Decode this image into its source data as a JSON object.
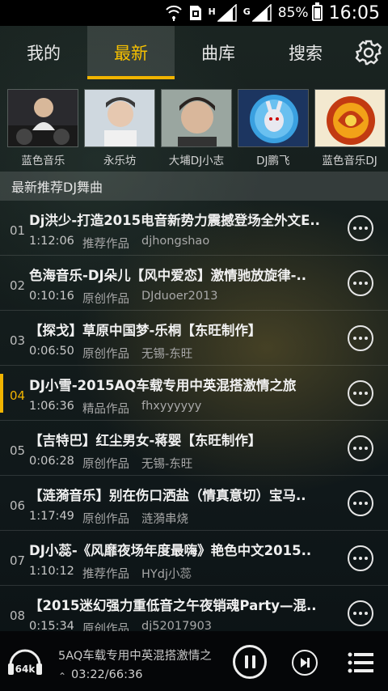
{
  "status_bar": {
    "network_letter_1": "H",
    "network_letter_2": "G",
    "battery": "85%",
    "time": "16:05"
  },
  "tabs": [
    {
      "label": "我的"
    },
    {
      "label": "最新"
    },
    {
      "label": "曲库"
    },
    {
      "label": "搜索"
    }
  ],
  "active_tab": "最新",
  "artists": [
    {
      "name": "蓝色音乐"
    },
    {
      "name": "永乐坊"
    },
    {
      "name": "大埔DJ小志"
    },
    {
      "name": "DJ鹏飞"
    },
    {
      "name": "蓝色音乐DJ"
    }
  ],
  "section_title": "最新推荐DJ舞曲",
  "tracks": [
    {
      "index": "01",
      "title": "Dj洪少-打造2015电音新势力震撼登场全外文E..",
      "duration": "1:12:06",
      "type": "推荐作品",
      "uploader": "djhongshao"
    },
    {
      "index": "02",
      "title": "色海音乐-DJ朵儿【风中爱恋】激情驰放旋律-..",
      "duration": "0:10:16",
      "type": "原创作品",
      "uploader": "DJduoer2013"
    },
    {
      "index": "03",
      "title": "【探戈】草原中国梦-乐桐【东旺制作】",
      "duration": "0:06:50",
      "type": "原创作品",
      "uploader": "无锡-东旺"
    },
    {
      "index": "04",
      "title": "DJ小雪-2015AQ车载专用中英混搭激情之旅",
      "duration": "1:06:36",
      "type": "精品作品",
      "uploader": "fhxyyyyyy"
    },
    {
      "index": "05",
      "title": "【吉特巴】红尘男女-蒋婴【东旺制作】",
      "duration": "0:06:28",
      "type": "原创作品",
      "uploader": "无锡-东旺"
    },
    {
      "index": "06",
      "title": "【涟漪音乐】别在伤口洒盐（情真意切）宝马..",
      "duration": "1:17:49",
      "type": "原创作品",
      "uploader": "涟漪串烧"
    },
    {
      "index": "07",
      "title": "DJ小蕊-《风靡夜场年度最嗨》艳色中文2015..",
      "duration": "1:10:12",
      "type": "推荐作品",
      "uploader": "HYdj小蕊"
    },
    {
      "index": "08",
      "title": "【2015迷幻强力重低音之午夜销魂Party—混..",
      "duration": "0:15:34",
      "type": "原创作品",
      "uploader": "dj52017903"
    }
  ],
  "active_track_index": 3,
  "player": {
    "quality": "64k",
    "now_playing": "5AQ车载专用中英混搭激情之",
    "progress": "03:22/66:36"
  },
  "colors": {
    "accent": "#f1b400"
  }
}
